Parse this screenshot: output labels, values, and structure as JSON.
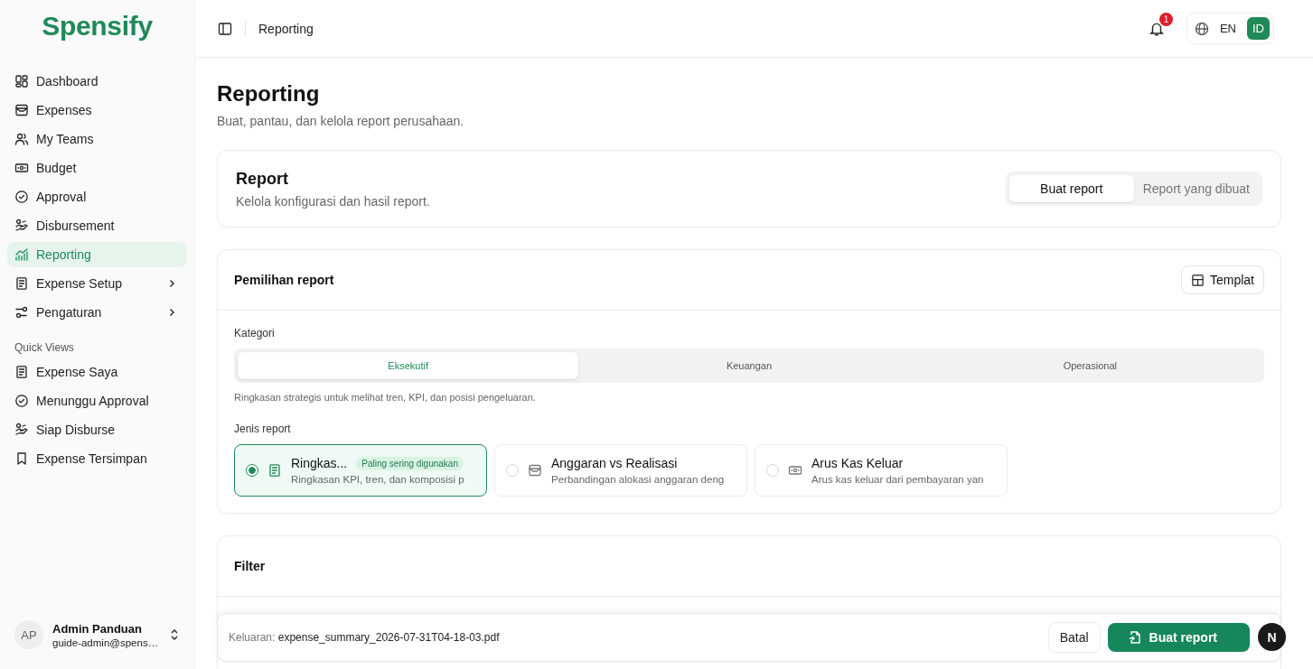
{
  "sidebar": {
    "logo": "Spensify",
    "nav": [
      {
        "label": "Dashboard",
        "kind": "grid",
        "selected": false,
        "expandable": false
      },
      {
        "label": "Expenses",
        "kind": "inbox",
        "selected": false,
        "expandable": false
      },
      {
        "label": "My Teams",
        "kind": "users",
        "selected": false,
        "expandable": false
      },
      {
        "label": "Budget",
        "kind": "money",
        "selected": false,
        "expandable": false
      },
      {
        "label": "Approval",
        "kind": "check",
        "selected": false,
        "expandable": false
      },
      {
        "label": "Disbursement",
        "kind": "hand",
        "selected": false,
        "expandable": false
      },
      {
        "label": "Reporting",
        "kind": "chart",
        "selected": true,
        "expandable": false
      },
      {
        "label": "Expense Setup",
        "kind": "doc",
        "selected": false,
        "expandable": true
      },
      {
        "label": "Pengaturan",
        "kind": "sliders",
        "selected": false,
        "expandable": true
      }
    ],
    "quick_views_title": "Quick Views",
    "quick_views": [
      {
        "label": "Expense Saya",
        "kind": "doc"
      },
      {
        "label": "Menunggu Approval",
        "kind": "check"
      },
      {
        "label": "Siap Disburse",
        "kind": "hand"
      },
      {
        "label": "Expense Tersimpan",
        "kind": "bookmark"
      }
    ],
    "user": {
      "initials": "AP",
      "name": "Admin Panduan",
      "email": "guide-admin@spens…"
    }
  },
  "header": {
    "breadcrumb": "Reporting",
    "notification_count": "1",
    "languages": [
      {
        "label": "EN",
        "selected": false
      },
      {
        "label": "ID",
        "selected": true
      }
    ]
  },
  "page": {
    "title": "Reporting",
    "subtitle": "Buat, pantau, dan kelola report perusahaan."
  },
  "report_card": {
    "title": "Report",
    "subtitle": "Kelola konfigurasi dan hasil report.",
    "tabs": [
      {
        "label": "Buat report",
        "selected": true
      },
      {
        "label": "Report yang dibuat",
        "selected": false
      }
    ]
  },
  "selection": {
    "title": "Pemilihan report",
    "template_button": "Templat",
    "category_label": "Kategori",
    "categories": [
      {
        "label": "Eksekutif",
        "selected": true
      },
      {
        "label": "Keuangan",
        "selected": false
      },
      {
        "label": "Operasional",
        "selected": false
      }
    ],
    "category_description": "Ringkasan strategis untuk melihat tren, KPI, dan posisi pengeluaran.",
    "type_label": "Jenis report",
    "types": [
      {
        "kind": "doc",
        "title": "Ringkas...",
        "badge": "Paling sering digunakan",
        "description": "Ringkasan KPI, tren, dan komposisi p",
        "selected": true
      },
      {
        "kind": "inbox",
        "title": "Anggaran vs Realisasi",
        "description": "Perbandingan alokasi anggaran deng",
        "selected": false
      },
      {
        "kind": "money",
        "title": "Arus Kas Keluar",
        "description": "Arus kas keluar dari pembayaran yan",
        "selected": false
      }
    ]
  },
  "filter": {
    "title": "Filter"
  },
  "action_bar": {
    "output_label": "Keluaran:",
    "output_file": "expense_summary_2026-07-31T04-18-03.pdf",
    "cancel_button": "Batal",
    "submit_button": "Buat report"
  },
  "floating_avatar": "N"
}
